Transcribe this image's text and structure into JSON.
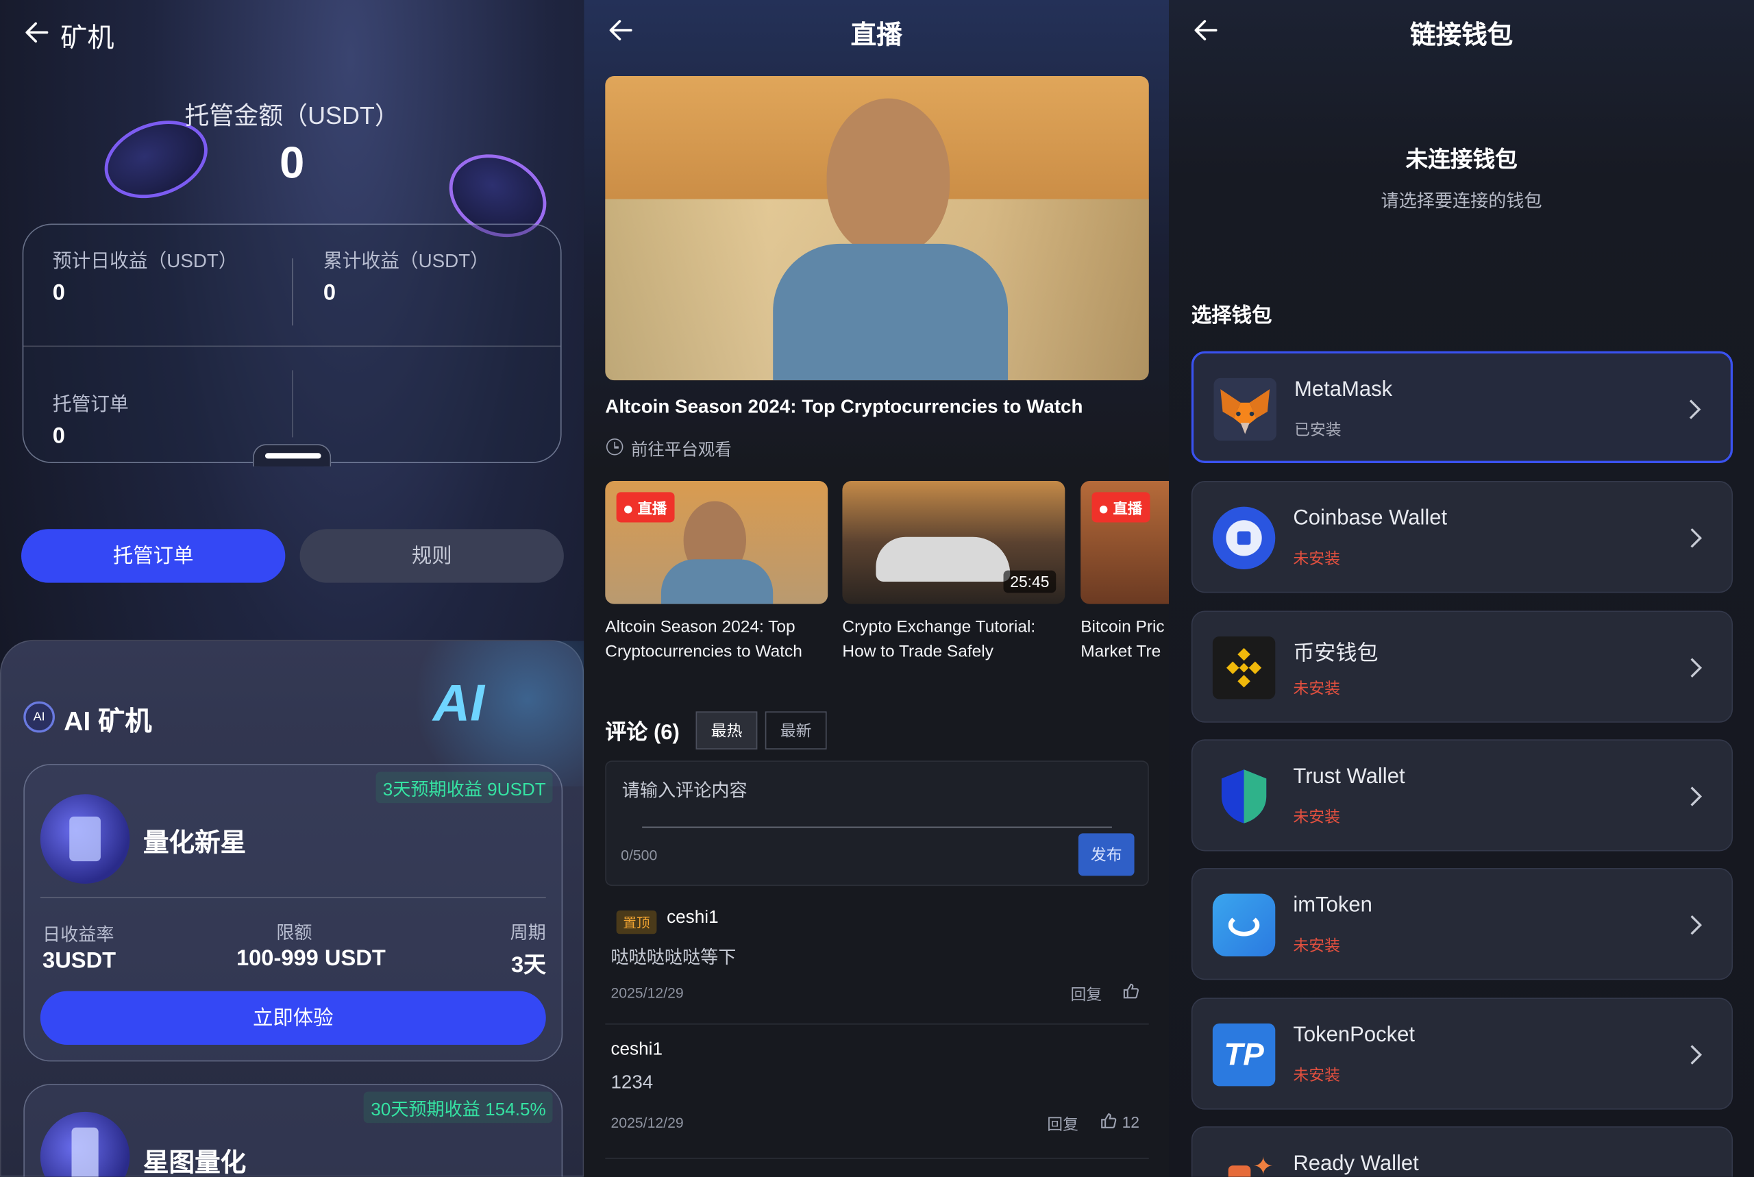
{
  "miner": {
    "title": "矿机",
    "hosted_label": "托管金额（USDT）",
    "hosted_value": "0",
    "daily_label": "预计日收益（USDT）",
    "daily_value": "0",
    "total_label": "累计收益（USDT）",
    "total_value": "0",
    "orders_label": "托管订单",
    "orders_value": "0",
    "btn_orders": "托管订单",
    "btn_rules": "规则",
    "ai_title": "AI 矿机",
    "ai_badge": "AI",
    "products": [
      {
        "name": "量化新星",
        "promo": "3天预期收益 9USDT",
        "rate_label": "日收益率",
        "rate": "3USDT",
        "limit_label": "限额",
        "limit": "100-999 USDT",
        "period_label": "周期",
        "period": "3天",
        "cta": "立即体验"
      },
      {
        "name": "星图量化",
        "promo": "30天预期收益 154.5%"
      }
    ]
  },
  "live": {
    "title": "直播",
    "main_title": "Altcoin Season 2024: Top Cryptocurrencies to Watch",
    "goto": "前往平台观看",
    "videos": [
      {
        "tag": "直播",
        "caption": "Altcoin Season 2024: Top Cryptocurrencies to Watch"
      },
      {
        "duration": "25:45",
        "caption": "Crypto Exchange Tutorial: How to Trade Safely"
      },
      {
        "tag": "直播",
        "caption": "Bitcoin Pric Market Tre"
      }
    ],
    "comments_label": "评论 (6)",
    "tab_hot": "最热",
    "tab_new": "最新",
    "input_placeholder": "请输入评论内容",
    "counter": "0/500",
    "publish": "发布",
    "comments": [
      {
        "pin": "置顶",
        "user": "ceshi1",
        "text": "哒哒哒哒哒等下",
        "date": "2025/12/29",
        "reply": "回复",
        "likes": ""
      },
      {
        "user": "ceshi1",
        "text": "1234",
        "date": "2025/12/29",
        "reply": "回复",
        "likes": "12"
      }
    ]
  },
  "wallet": {
    "title": "链接钱包",
    "status": "未连接钱包",
    "hint": "请选择要连接的钱包",
    "section": "选择钱包",
    "items": [
      {
        "name": "MetaMask",
        "status": "已安装"
      },
      {
        "name": "Coinbase Wallet",
        "status": "未安装"
      },
      {
        "name": "币安钱包",
        "status": "未安装"
      },
      {
        "name": "Trust Wallet",
        "status": "未安装"
      },
      {
        "name": "imToken",
        "status": "未安装"
      },
      {
        "name": "TokenPocket",
        "status": "未安装"
      },
      {
        "name": "Ready Wallet",
        "status": ""
      }
    ],
    "colors": {
      "installed": "#a7aab8",
      "not_installed": "#e2503f",
      "accent": "#3448f5"
    }
  }
}
